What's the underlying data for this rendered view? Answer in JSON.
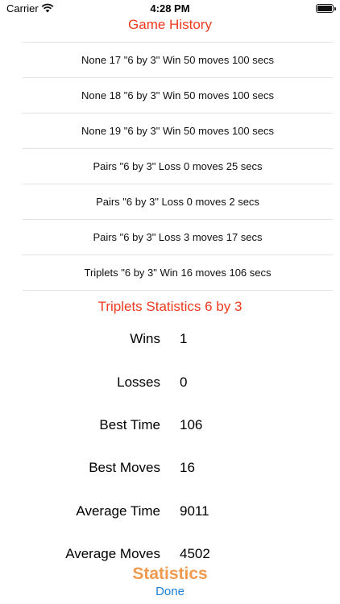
{
  "status_bar": {
    "carrier": "Carrier",
    "time": "4:28 PM",
    "wifi_icon": "wifi-icon",
    "battery_icon": "battery-icon"
  },
  "header": {
    "title": "Game History"
  },
  "history": [
    {
      "text": "None 17 \"6 by 3\" Win 50 moves 100 secs"
    },
    {
      "text": "None 18 \"6 by 3\" Win 50 moves 100 secs"
    },
    {
      "text": "None 19 \"6 by 3\" Win 50 moves 100 secs"
    },
    {
      "text": "Pairs \"6 by 3\" Loss 0 moves 25 secs"
    },
    {
      "text": "Pairs \"6 by 3\" Loss 0 moves 2 secs"
    },
    {
      "text": "Pairs \"6 by 3\" Loss 3 moves 17 secs"
    },
    {
      "text": "Triplets \"6 by 3\" Win 16 moves 106 secs"
    }
  ],
  "statistics": {
    "title": "Triplets Statistics 6 by 3",
    "rows": [
      {
        "label": "Wins",
        "value": "1"
      },
      {
        "label": "Losses",
        "value": "0"
      },
      {
        "label": "Best Time",
        "value": "106"
      },
      {
        "label": "Best Moves",
        "value": "16"
      },
      {
        "label": "Average Time",
        "value": "9011"
      },
      {
        "label": "Average Moves",
        "value": "4502"
      }
    ]
  },
  "footer": {
    "title": "Statistics",
    "done_label": "Done"
  },
  "colors": {
    "title_red": "#ee3a1e",
    "footer_orange": "#f09a4f",
    "link_blue": "#1a7fd6"
  }
}
